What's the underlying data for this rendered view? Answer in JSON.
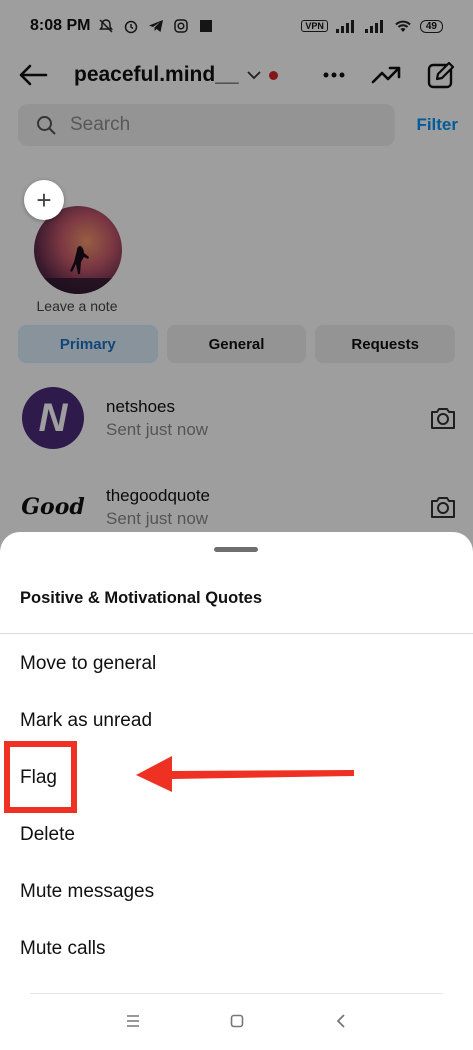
{
  "status_bar": {
    "time": "8:08 PM",
    "vpn_label": "VPN",
    "battery": "49"
  },
  "header": {
    "username": "peaceful.mind__"
  },
  "search": {
    "placeholder": "Search",
    "filter_label": "Filter"
  },
  "note": {
    "label": "Leave a note"
  },
  "tabs": [
    {
      "label": "Primary",
      "active": true
    },
    {
      "label": "General",
      "active": false
    },
    {
      "label": "Requests",
      "active": false
    }
  ],
  "threads": [
    {
      "name": "netshoes",
      "status": "Sent just now",
      "avatar_letter": "N"
    },
    {
      "name": "thegoodquote",
      "status": "Sent just now",
      "avatar_letter": "Good"
    }
  ],
  "sheet": {
    "title": "Positive & Motivational Quotes",
    "items": [
      {
        "label": "Move to general"
      },
      {
        "label": "Mark as unread"
      },
      {
        "label": "Flag"
      },
      {
        "label": "Delete"
      },
      {
        "label": "Mute messages"
      },
      {
        "label": "Mute calls"
      }
    ]
  },
  "annotation": {
    "color": "#ee3122",
    "target": "Flag"
  },
  "colors": {
    "accent": "#0095f6",
    "primary_tab_bg": "#dcedfc",
    "primary_tab_text": "#1d71c4",
    "unread_dot": "#d2252d"
  }
}
